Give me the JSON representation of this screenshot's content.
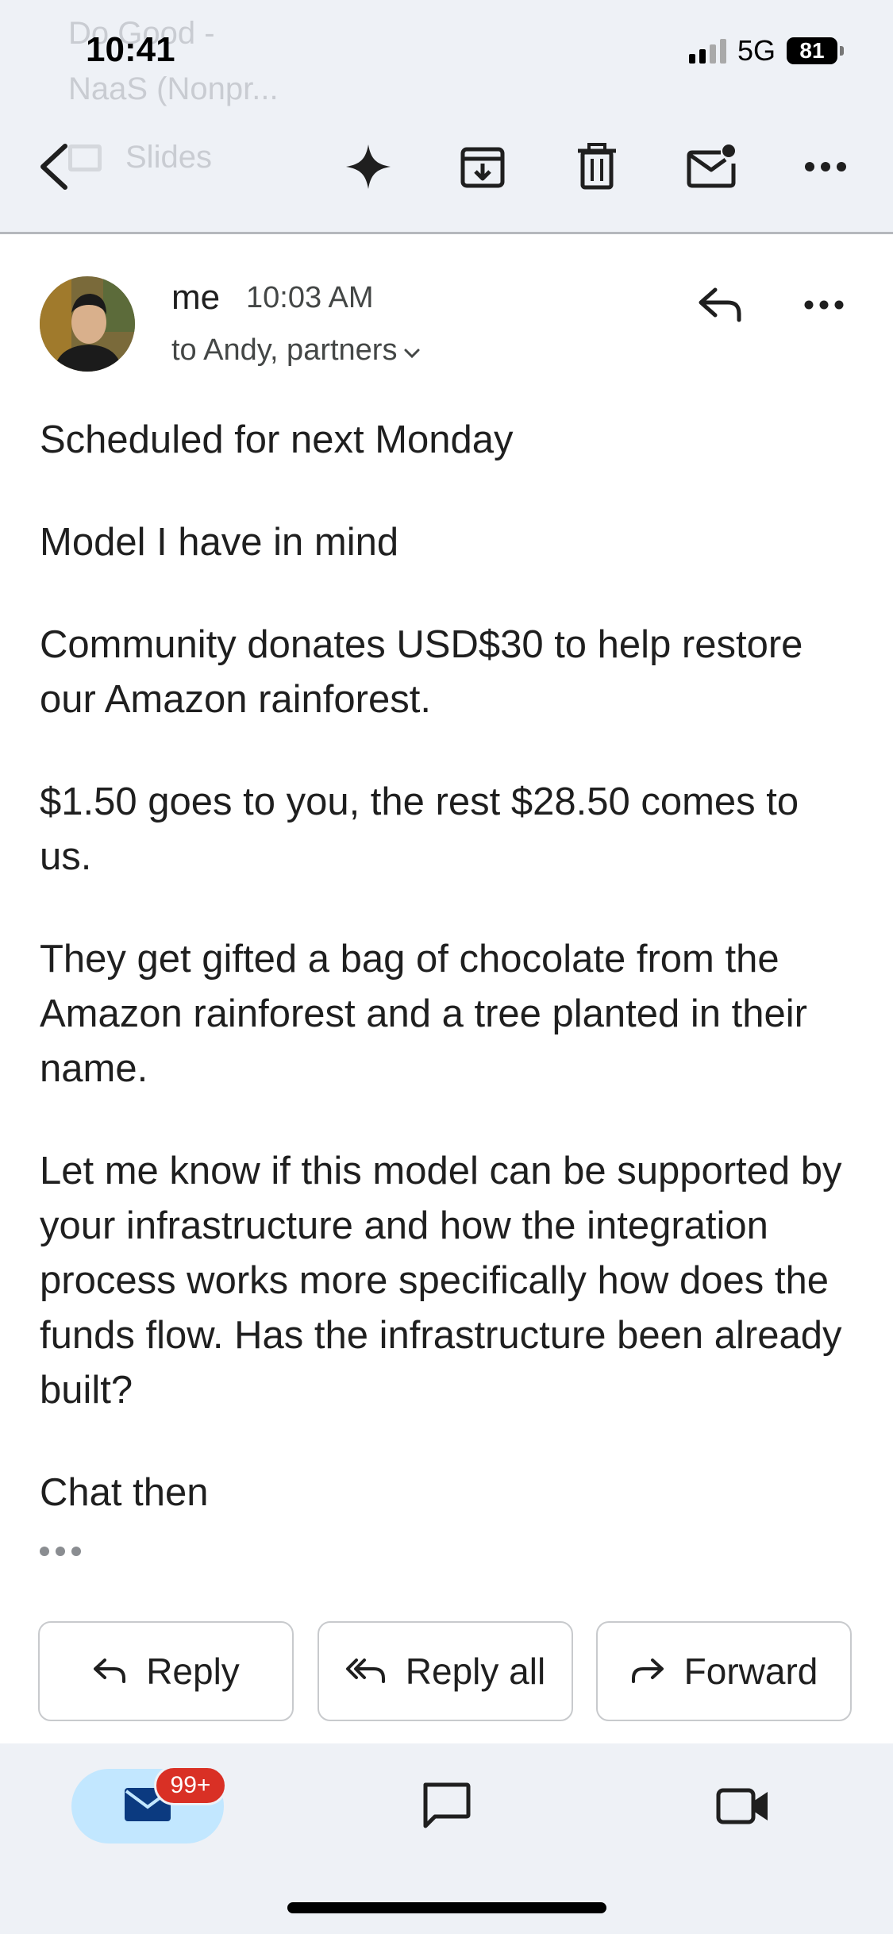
{
  "status_bar": {
    "time": "10:41",
    "network": "5G",
    "battery": "81"
  },
  "background_header": {
    "sender_line1": "Do Good -",
    "sender_line2": "NaaS (Nonpr...",
    "attachment": "Slides"
  },
  "toolbar": {
    "icons": [
      "back-arrow-icon",
      "gemini-sparkle-icon",
      "archive-icon",
      "trash-icon",
      "mark-unread-icon",
      "more-icon"
    ]
  },
  "message": {
    "sender": "me",
    "time": "10:03 AM",
    "recipients": "to Andy, partners",
    "paragraphs": [
      "Scheduled for next Monday",
      "Model I have in mind",
      "Community donates USD$30 to help restore our Amazon rainforest.",
      "$1.50 goes to you, the rest $28.50 comes to us.",
      "They get gifted a bag of chocolate from the Amazon rainforest and a tree planted in their name.",
      "Let me know if this model can be supported by your infrastructure and how the integration process works more specifically how does the funds flow. Has the infrastructure been already built?",
      "Chat then"
    ]
  },
  "actions": {
    "reply": "Reply",
    "reply_all": "Reply all",
    "forward": "Forward"
  },
  "bottom_nav": {
    "mail_badge": "99+",
    "items": [
      "mail-icon",
      "chat-icon",
      "meet-icon"
    ]
  },
  "colors": {
    "header_bg": "#eef1f6",
    "active_pill": "#c2e7ff",
    "badge": "#d93025",
    "text": "#1f1f1f",
    "secondary": "#444746"
  }
}
